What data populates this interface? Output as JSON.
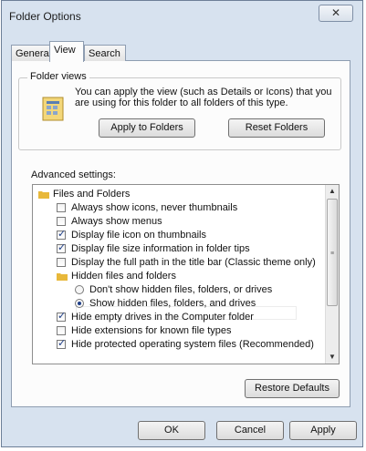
{
  "window": {
    "title": "Folder Options",
    "close_glyph": "✕"
  },
  "tabs": [
    {
      "label": "General"
    },
    {
      "label": "View"
    },
    {
      "label": "Search"
    }
  ],
  "folder_views": {
    "group_label": "Folder views",
    "description": "You can apply the view (such as Details or Icons) that you are using for this folder to all folders of this type.",
    "apply_button": "Apply to Folders",
    "reset_button": "Reset Folders",
    "icon": "folder-view-icon"
  },
  "advanced": {
    "label": "Advanced settings:",
    "items": [
      {
        "type": "folder",
        "label": "Files and Folders"
      },
      {
        "type": "checkbox",
        "checked": false,
        "label": "Always show icons, never thumbnails"
      },
      {
        "type": "checkbox",
        "checked": false,
        "label": "Always show menus"
      },
      {
        "type": "checkbox",
        "checked": true,
        "label": "Display file icon on thumbnails"
      },
      {
        "type": "checkbox",
        "checked": true,
        "label": "Display file size information in folder tips"
      },
      {
        "type": "checkbox",
        "checked": false,
        "label": "Display the full path in the title bar (Classic theme only)"
      },
      {
        "type": "folder",
        "label": "Hidden files and folders"
      },
      {
        "type": "radio",
        "checked": false,
        "label": "Don't show hidden files, folders, or drives"
      },
      {
        "type": "radio",
        "checked": true,
        "label": "Show hidden files, folders, and drives"
      },
      {
        "type": "checkbox",
        "checked": true,
        "label": "Hide empty drives in the Computer folder"
      },
      {
        "type": "checkbox",
        "checked": false,
        "label": "Hide extensions for known file types"
      },
      {
        "type": "checkbox",
        "checked": true,
        "label": "Hide protected operating system files (Recommended)"
      }
    ],
    "restore_button": "Restore Defaults"
  },
  "footer": {
    "ok": "OK",
    "cancel": "Cancel",
    "apply": "Apply"
  },
  "colors": {
    "accent": "#1e3e88",
    "window_bg": "#d7e2ef",
    "folder": "#e8b83a"
  }
}
